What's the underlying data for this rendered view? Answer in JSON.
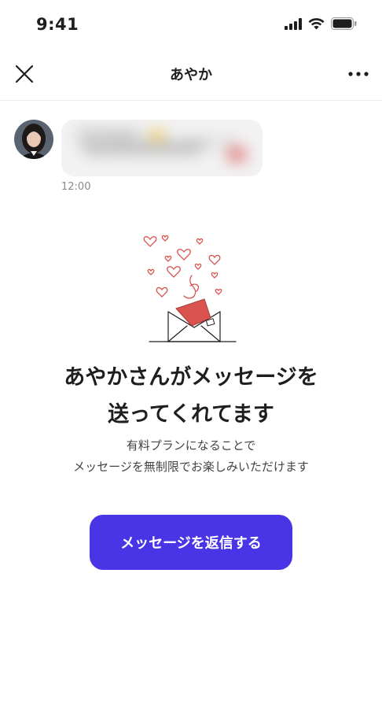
{
  "status_bar": {
    "time": "9:41",
    "icons": [
      "signal-icon",
      "wifi-icon",
      "battery-icon"
    ]
  },
  "nav": {
    "title": "あやか",
    "close_icon": "close-icon",
    "more_icon": "more-icon"
  },
  "message": {
    "preview": "こんにちは 😊 はじめまして",
    "time": "12:00"
  },
  "illustration": "envelope-hearts-illustration",
  "headline": {
    "line1": "あやかさんがメッセージを",
    "line2": "送ってくれてます"
  },
  "subtext": {
    "line1": "有料プランになることで",
    "line2": "メッセージを無制限でお楽しみいただけます"
  },
  "cta": {
    "label": "メッセージを返信する"
  },
  "colors": {
    "accent": "#4a35e6",
    "heart": "#d9534f",
    "background": "#ffffff"
  }
}
